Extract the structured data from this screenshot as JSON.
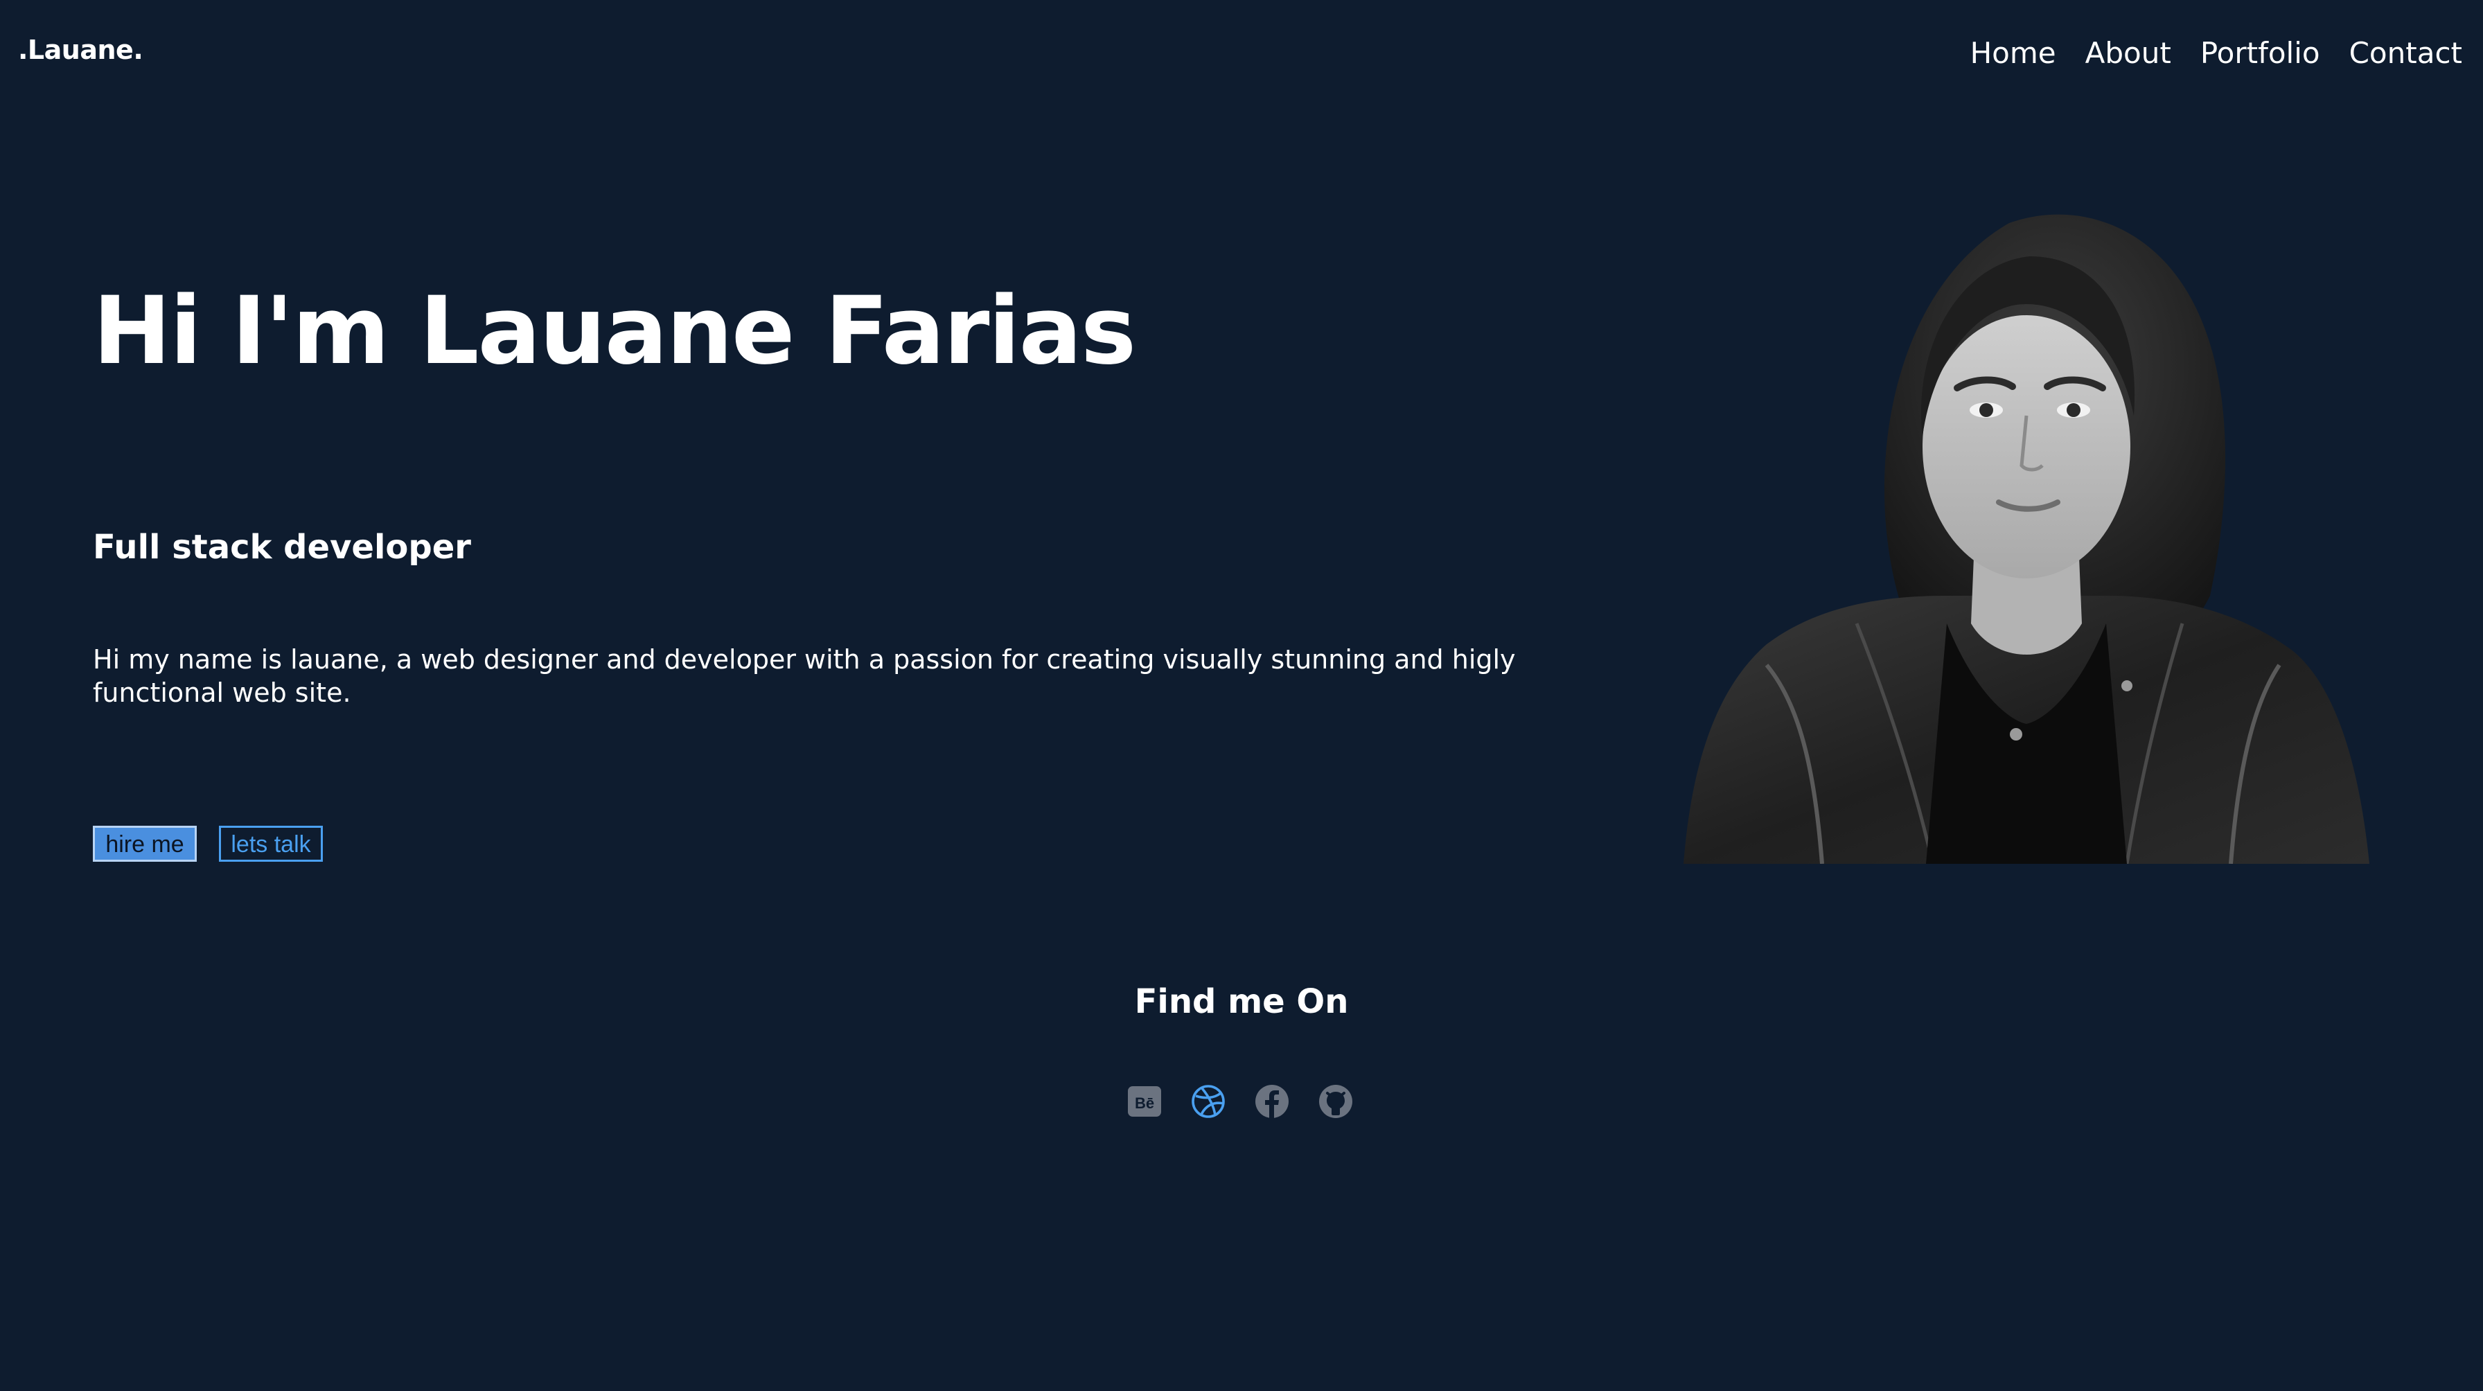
{
  "brand": {
    "logo": ".Lauane."
  },
  "nav": {
    "items": [
      {
        "label": "Home"
      },
      {
        "label": "About"
      },
      {
        "label": "Portfolio"
      },
      {
        "label": "Contact"
      }
    ]
  },
  "hero": {
    "title": "Hi I'm Lauane Farias",
    "subtitle": "Full stack developer",
    "bio": "Hi my name is lauane, a web designer and developer with a passion for creating visually stunning and higly functional web site.",
    "buttons": {
      "hire": "hire me",
      "talk": "lets talk"
    }
  },
  "find": {
    "title": "Find me On",
    "icons": [
      {
        "name": "behance-icon",
        "glyph": "Bē"
      },
      {
        "name": "dribbble-icon"
      },
      {
        "name": "facebook-icon"
      },
      {
        "name": "github-icon"
      }
    ]
  },
  "colors": {
    "background": "#0e1c2f",
    "accent": "#4aa0f0",
    "icon_muted": "#6b7380",
    "text": "#ffffff"
  }
}
